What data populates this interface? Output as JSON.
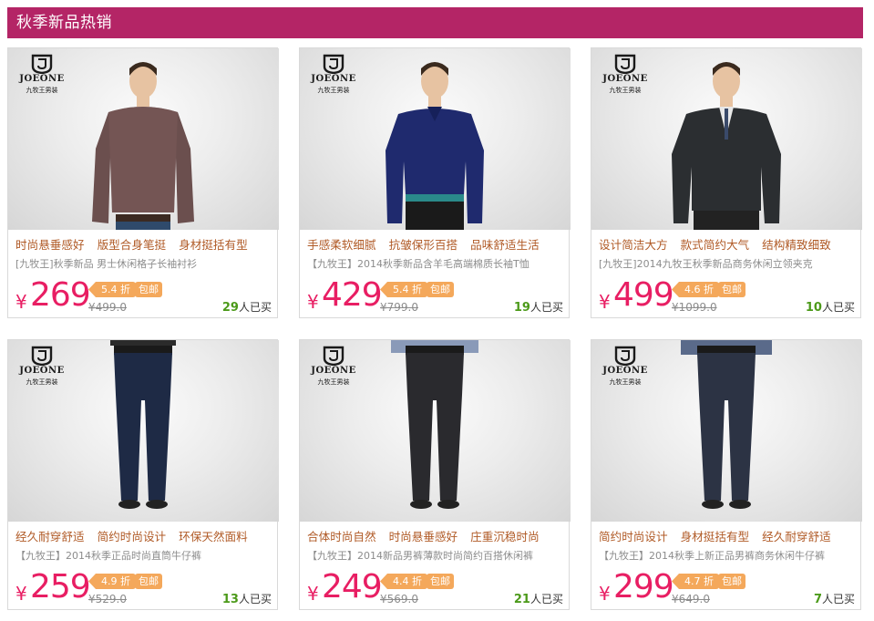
{
  "section_title": "秋季新品热销",
  "brand": {
    "name": "JOEONE",
    "tagline": "九牧王男装"
  },
  "colors": {
    "accent": "#b42566",
    "price": "#e81e63",
    "tag": "#f4a85b",
    "sold_count": "#4c9a1a"
  },
  "products": [
    {
      "features": [
        "时尚悬垂感好",
        "版型合身笔挺",
        "身材挺括有型"
      ],
      "desc": "[九牧王]秋季新品 男士休闲格子长袖衬衫",
      "price": "269",
      "discount": "5.4 折",
      "free_ship": "包邮",
      "original": "¥499.0",
      "sold_count": "29",
      "sold_label": "人已买",
      "item": "shirt"
    },
    {
      "features": [
        "手感柔软细腻",
        "抗皱保形百搭",
        "品味舒适生活"
      ],
      "desc": "【九牧王】2014秋季新品含羊毛高端棉质长袖T恤",
      "price": "429",
      "discount": "5.4 折",
      "free_ship": "包邮",
      "original": "¥799.0",
      "sold_count": "19",
      "sold_label": "人已买",
      "item": "polo"
    },
    {
      "features": [
        "设计简洁大方",
        "款式简约大气",
        "结构精致细致"
      ],
      "desc": "[九牧王]2014九牧王秋季新品商务休闲立领夹克",
      "price": "499",
      "discount": "4.6 折",
      "free_ship": "包邮",
      "original": "¥1099.0",
      "sold_count": "10",
      "sold_label": "人已买",
      "item": "jacket"
    },
    {
      "features": [
        "经久耐穿舒适",
        "简约时尚设计",
        "环保天然面料"
      ],
      "desc": "【九牧王】2014秋季正品时尚直筒牛仔裤",
      "price": "259",
      "discount": "4.9 折",
      "free_ship": "包邮",
      "original": "¥529.0",
      "sold_count": "13",
      "sold_label": "人已买",
      "item": "jeans"
    },
    {
      "features": [
        "合体时尚自然",
        "时尚悬垂感好",
        "庄重沉稳时尚"
      ],
      "desc": "【九牧王】2014新品男裤薄款时尚简约百搭休闲裤",
      "price": "249",
      "discount": "4.4 折",
      "free_ship": "包邮",
      "original": "¥569.0",
      "sold_count": "21",
      "sold_label": "人已买",
      "item": "trousers"
    },
    {
      "features": [
        "简约时尚设计",
        "身材挺括有型",
        "经久耐穿舒适"
      ],
      "desc": "【九牧王】2014秋季上新正品男裤商务休闲牛仔裤",
      "price": "299",
      "discount": "4.7 折",
      "free_ship": "包邮",
      "original": "¥649.0",
      "sold_count": "7",
      "sold_label": "人已买",
      "item": "jeans2"
    }
  ]
}
